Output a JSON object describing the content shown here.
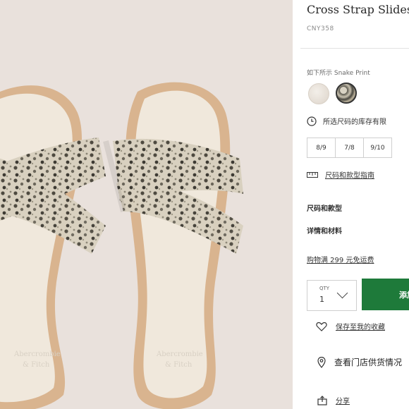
{
  "product": {
    "title": "Cross Strap Slides",
    "sku": "CNY358"
  },
  "colors": {
    "label": "如下所示 Snake Print",
    "swatches": [
      {
        "name": "white-swatch",
        "hex": "#ebe5de"
      },
      {
        "name": "snake-print-swatch",
        "hex": "#6e6a5e",
        "selected": true
      }
    ]
  },
  "stock_notice": "所选尺码的库存有限",
  "sizes": [
    "8/9",
    "7/8",
    "9/10"
  ],
  "size_guide": "尺码和款型指南",
  "sections": {
    "size_fit": "尺码和款型",
    "details": "详情和材料"
  },
  "shipping_note": "购物满 299 元免运费",
  "quantity": {
    "label": "QTY",
    "value": "1"
  },
  "add_to_bag_label": "添加",
  "wishlist_label": "保存至我的收藏",
  "store_availability": "查看门店供货情况",
  "share_label": "分享",
  "photo": {
    "logo_text_left": "Abercrombie & Fitch",
    "logo_text_right": "Abercrombie & Fitch"
  },
  "theme": {
    "accent": "#1e7a3a",
    "photo_bg": "#e9e1dc"
  }
}
